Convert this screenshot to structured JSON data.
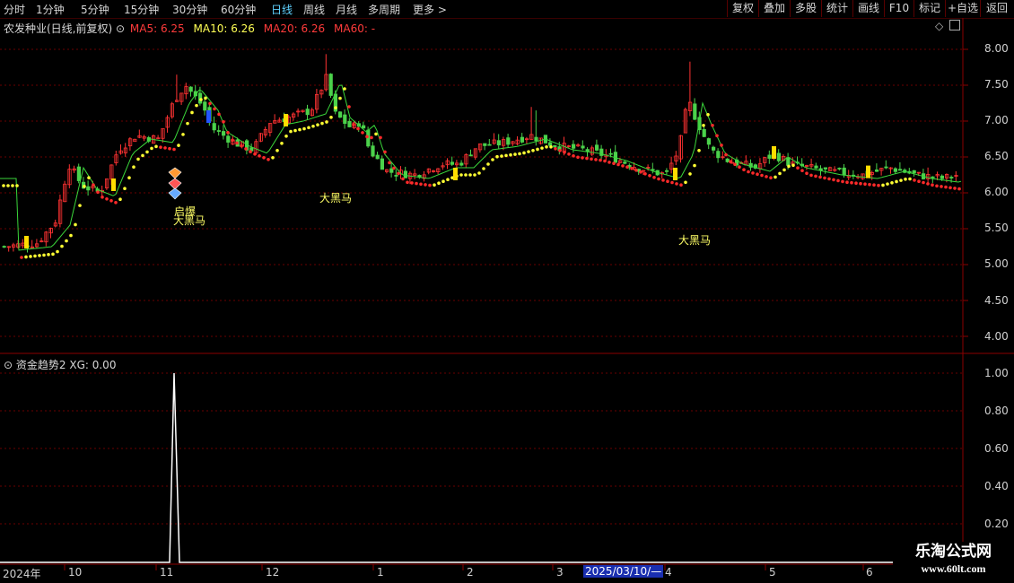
{
  "toolbar": {
    "periods": [
      "分时",
      "1分钟",
      "5分钟",
      "15分钟",
      "30分钟",
      "60分钟",
      "日线",
      "周线",
      "月线",
      "多周期",
      "更多 >"
    ],
    "active_period": "日线",
    "right_buttons": [
      "复权",
      "叠加",
      "多股",
      "统计",
      "画线",
      "F10",
      "标记",
      "+自选",
      "返回"
    ]
  },
  "main_pane": {
    "title": "农发种业(日线,前复权)",
    "ma5": "MA5: 6.25",
    "ma10": "MA10: 6.26",
    "ma20": "MA20: 6.26",
    "ma60": "MA60: -",
    "y_ticks": [
      "8.00",
      "7.50",
      "7.00",
      "6.50",
      "6.00",
      "5.50",
      "5.00",
      "4.50",
      "4.00"
    ],
    "annotations": [
      "启爆",
      "大黑马",
      "大黑马",
      "大黑马"
    ]
  },
  "sub_pane": {
    "title": "资金趋势2",
    "xg": "XG: 0.00",
    "y_ticks": [
      "1.00",
      "0.80",
      "0.60",
      "0.40",
      "0.20"
    ]
  },
  "x_axis": {
    "labels": [
      "2024年",
      "10",
      "11",
      "12",
      "1",
      "2",
      "3",
      "2025/03/10/—",
      "4",
      "5",
      "6"
    ]
  },
  "watermark": {
    "title": "乐淘公式网",
    "url": "www.60lt.com"
  },
  "colors": {
    "up": "#ff3232",
    "down": "#4bd24b",
    "ma_yellow": "#ffff33",
    "ma_red": "#ff2a2a",
    "axis_red": "#8b0000",
    "active": "#5fd2ff"
  }
}
